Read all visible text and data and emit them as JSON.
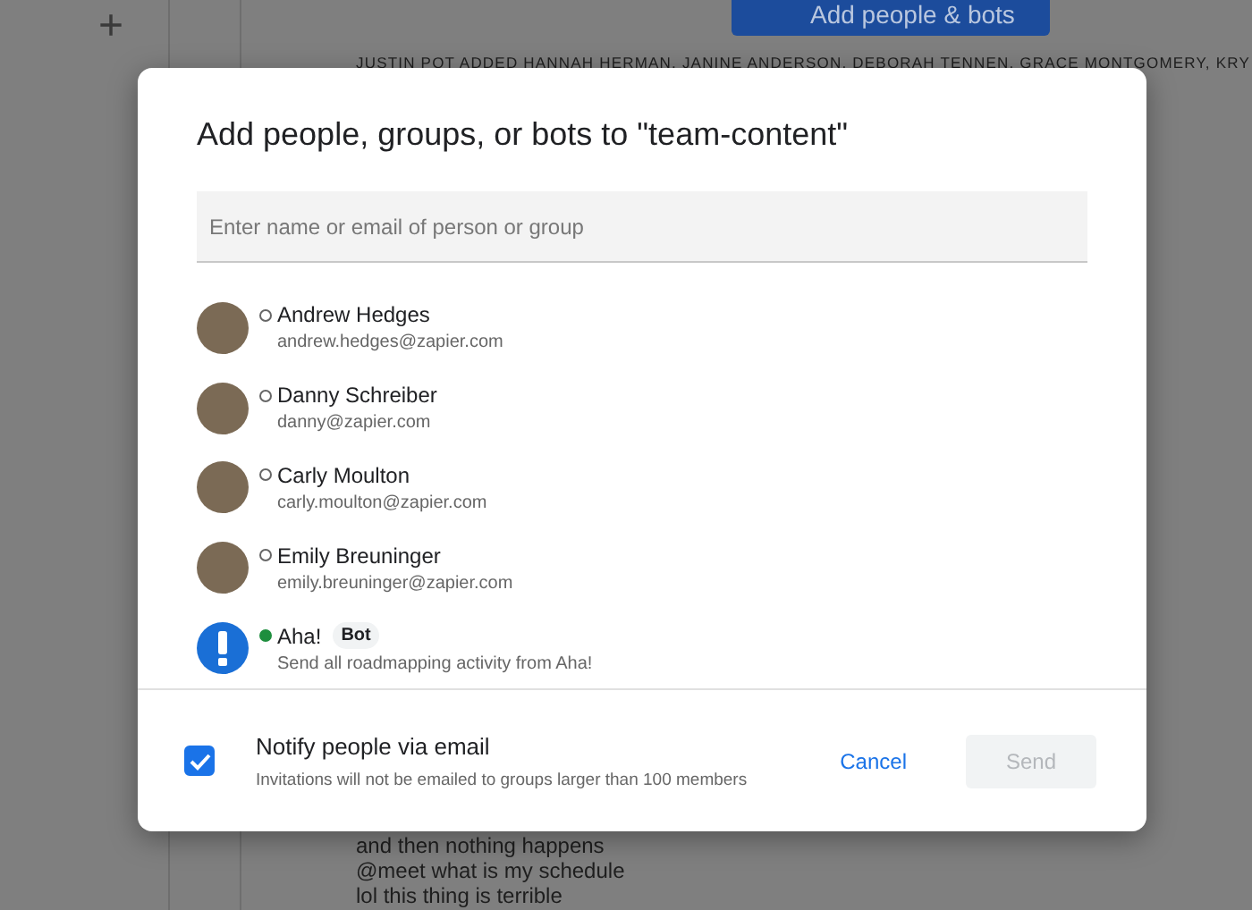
{
  "background": {
    "add_button": "+",
    "invite_button": "Add people & bots",
    "system_message": "JUSTIN POT ADDED HANNAH HERMAN, JANINE ANDERSON, DEBORAH TENNEN, GRACE MONTGOMERY, KRY",
    "messages": [
      "and then nothing happens",
      "@meet what is my schedule",
      "lol this thing is terrible"
    ]
  },
  "dialog": {
    "title": "Add people, groups, or bots to \"team-content\"",
    "search": {
      "placeholder": "Enter name or email of person or group"
    },
    "people": [
      {
        "kind": "person",
        "name": "Andrew Hedges",
        "detail": "andrew.hedges@zapier.com",
        "online": false
      },
      {
        "kind": "person",
        "name": "Danny Schreiber",
        "detail": "danny@zapier.com",
        "online": false
      },
      {
        "kind": "person",
        "name": "Carly Moulton",
        "detail": "carly.moulton@zapier.com",
        "online": false
      },
      {
        "kind": "person",
        "name": "Emily Breuninger",
        "detail": "emily.breuninger@zapier.com",
        "online": false
      },
      {
        "kind": "bot",
        "name": "Aha!",
        "badge": "Bot",
        "detail": "Send all roadmapping activity from Aha!",
        "online": true
      }
    ],
    "notify": {
      "label": "Notify people via email",
      "hint": "Invitations will not be emailed to groups larger than 100 members",
      "checked": true
    },
    "buttons": [
      {
        "label": "Cancel",
        "disabled": false
      },
      {
        "label": "Send",
        "disabled": true
      }
    ]
  }
}
